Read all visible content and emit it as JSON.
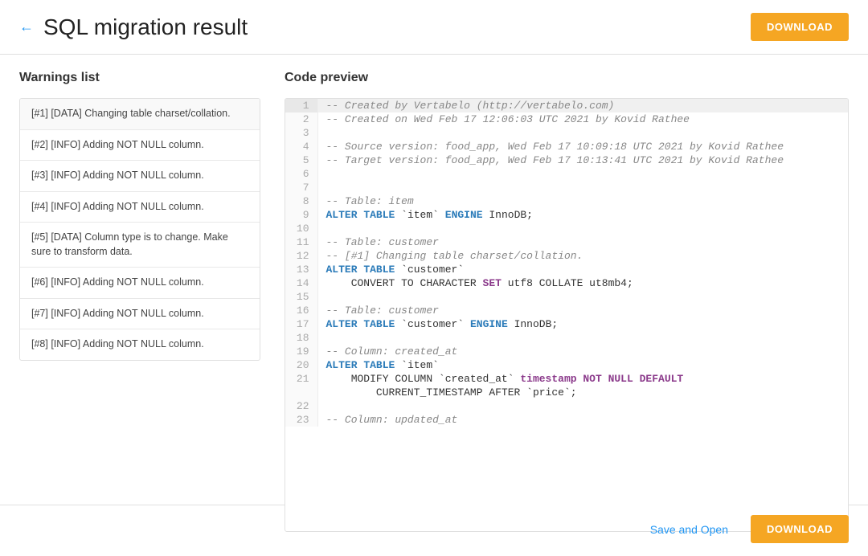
{
  "header": {
    "back_arrow": "←",
    "title": "SQL migration result",
    "download_label": "DOWNLOAD"
  },
  "warnings_panel": {
    "title": "Warnings list",
    "items": [
      "[#1] [DATA] Changing table charset/collation.",
      "[#2] [INFO] Adding NOT NULL column.",
      "[#3] [INFO] Adding NOT NULL column.",
      "[#4] [INFO] Adding NOT NULL column.",
      "[#5] [DATA] Column type is to change. Make sure to transform data.",
      "[#6] [INFO] Adding NOT NULL column.",
      "[#7] [INFO] Adding NOT NULL column.",
      "[#8] [INFO] Adding NOT NULL column."
    ]
  },
  "code_panel": {
    "title": "Code preview"
  },
  "footer": {
    "save_open_label": "Save and Open",
    "download_label": "DOWNLOAD"
  }
}
